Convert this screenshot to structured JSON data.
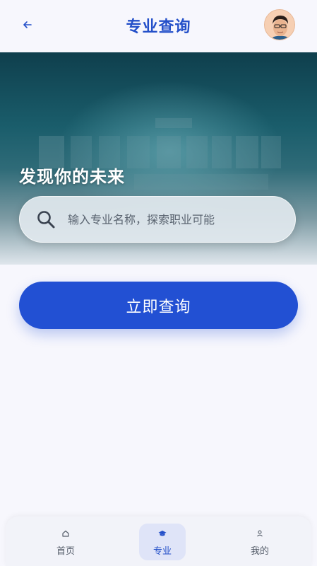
{
  "header": {
    "title": "专业查询",
    "back_icon": "arrow-left-icon",
    "avatar_icon": "user-avatar"
  },
  "hero": {
    "headline": "发现你的未来",
    "search": {
      "placeholder": "输入专业名称，探索职业可能",
      "value": ""
    }
  },
  "primary_button": {
    "label": "立即查询"
  },
  "bottom_nav": {
    "items": [
      {
        "label": "首页",
        "icon": "home-icon",
        "active": false
      },
      {
        "label": "专业",
        "icon": "graduation-cap-icon",
        "active": true
      },
      {
        "label": "我的",
        "icon": "person-icon",
        "active": false
      }
    ]
  },
  "colors": {
    "accent": "#2450c9",
    "button": "#2250d3",
    "background": "#f7f7fd"
  }
}
